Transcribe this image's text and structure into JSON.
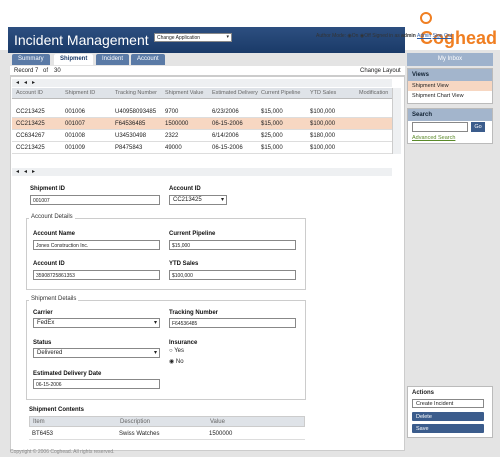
{
  "app": {
    "title": "Incident Management",
    "change_app": "Change Application"
  },
  "author": {
    "mode_label": "Author Mode:",
    "on": "On",
    "off": "Off",
    "signed_in": "Signed in as",
    "user": "admin",
    "admin_link": "Admin",
    "signout": "Sign Out"
  },
  "logo": {
    "text": "Coghead"
  },
  "tabs": [
    {
      "label": "Summary"
    },
    {
      "label": "Shipment"
    },
    {
      "label": "Incident"
    },
    {
      "label": "Account"
    }
  ],
  "inbox": "My Inbox",
  "nav": {
    "record_label": "Record",
    "record_num": "7",
    "of_label": "of",
    "total": "30",
    "layout": "Change Layout"
  },
  "grid": {
    "columns": [
      "Account ID",
      "Shipment ID",
      "Tracking Number",
      "Shipment Value",
      "Estimated Delivery",
      "Current Pipeline",
      "YTD Sales",
      "Modification"
    ],
    "rows": [
      [
        "CC213425",
        "001006",
        "U40958093485",
        "9700",
        "6/23/2006",
        "$15,000",
        "$100,000",
        ""
      ],
      [
        "CC213425",
        "001007",
        "F64536485",
        "1500000",
        "06-15-2006",
        "$15,000",
        "$100,000",
        ""
      ],
      [
        "CC634267",
        "001008",
        "U34530498",
        "2322",
        "6/14/2006",
        "$25,000",
        "$180,000",
        ""
      ],
      [
        "CC213425",
        "001009",
        "P8475843",
        "49000",
        "06-15-2006",
        "$15,000",
        "$100,000",
        ""
      ]
    ]
  },
  "form": {
    "shipment_id_label": "Shipment ID",
    "shipment_id": "001007",
    "account_id_label": "Account ID",
    "account_id": "CC213425",
    "account_details_title": "Account Details",
    "account_name_label": "Account Name",
    "account_name": "Jones Construction Inc.",
    "current_pipeline_label": "Current Pipeline",
    "current_pipeline": "$15,000",
    "account_id2_label": "Account ID",
    "account_id2": "35908725861353",
    "ytd_sales_label": "YTD Sales",
    "ytd_sales": "$100,000",
    "shipment_details_title": "Shipment Details",
    "carrier_label": "Carrier",
    "carrier": "FedEx",
    "tracking_label": "Tracking Number",
    "tracking": "F64536485",
    "status_label": "Status",
    "status": "Delivered",
    "insurance_label": "Insurance",
    "ins_yes": "Yes",
    "ins_no": "No",
    "est_delivery_label": "Estimated Delivery Date",
    "est_delivery": "06-15-2006",
    "contents_title": "Shipment Contents",
    "contents_columns": [
      "Item",
      "Description",
      "Value"
    ],
    "contents_rows": [
      [
        "BT6453",
        "Swiss Watches",
        "1500000"
      ]
    ]
  },
  "views": {
    "title": "Views",
    "items": [
      "Shipment View",
      "Shipment Chart View"
    ]
  },
  "search": {
    "title": "Search",
    "go": "Go",
    "advanced": "Advanced Search"
  },
  "actions": {
    "title": "Actions",
    "create": "Create Incident",
    "delete": "Delete",
    "save": "Save"
  },
  "footer": "Copyright © 2006 Coghead. All rights reserved."
}
